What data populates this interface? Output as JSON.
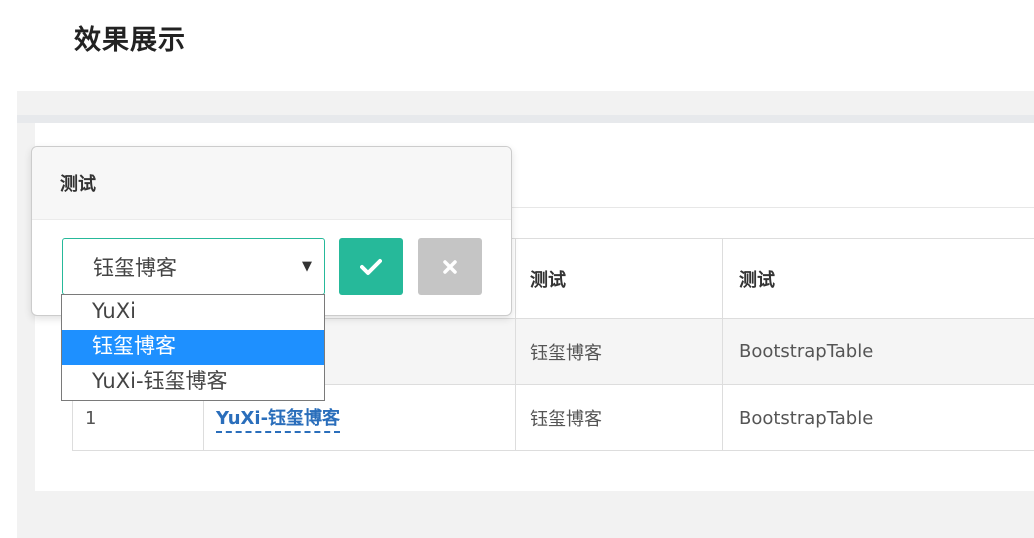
{
  "page": {
    "title": "效果展示"
  },
  "table": {
    "columns": [
      "",
      "",
      "测试",
      "测试"
    ],
    "rows": [
      {
        "id": "",
        "name": "",
        "col3": "钰玺博客",
        "col4": "BootstrapTable"
      },
      {
        "id": "1",
        "name": "YuXi-钰玺博客",
        "col3": "钰玺博客",
        "col4": "BootstrapTable"
      }
    ]
  },
  "popover": {
    "title": "测试",
    "select": {
      "value": "钰玺博客",
      "options": [
        "YuXi",
        "钰玺博客",
        "YuXi-钰玺博客"
      ],
      "selected_index": 1
    },
    "ok_icon": "check-icon",
    "cancel_icon": "close-icon"
  },
  "colors": {
    "accent": "#26b99a",
    "link": "#2a6ebb",
    "option_highlight": "#1e90ff",
    "cancel": "#c5c5c5"
  }
}
